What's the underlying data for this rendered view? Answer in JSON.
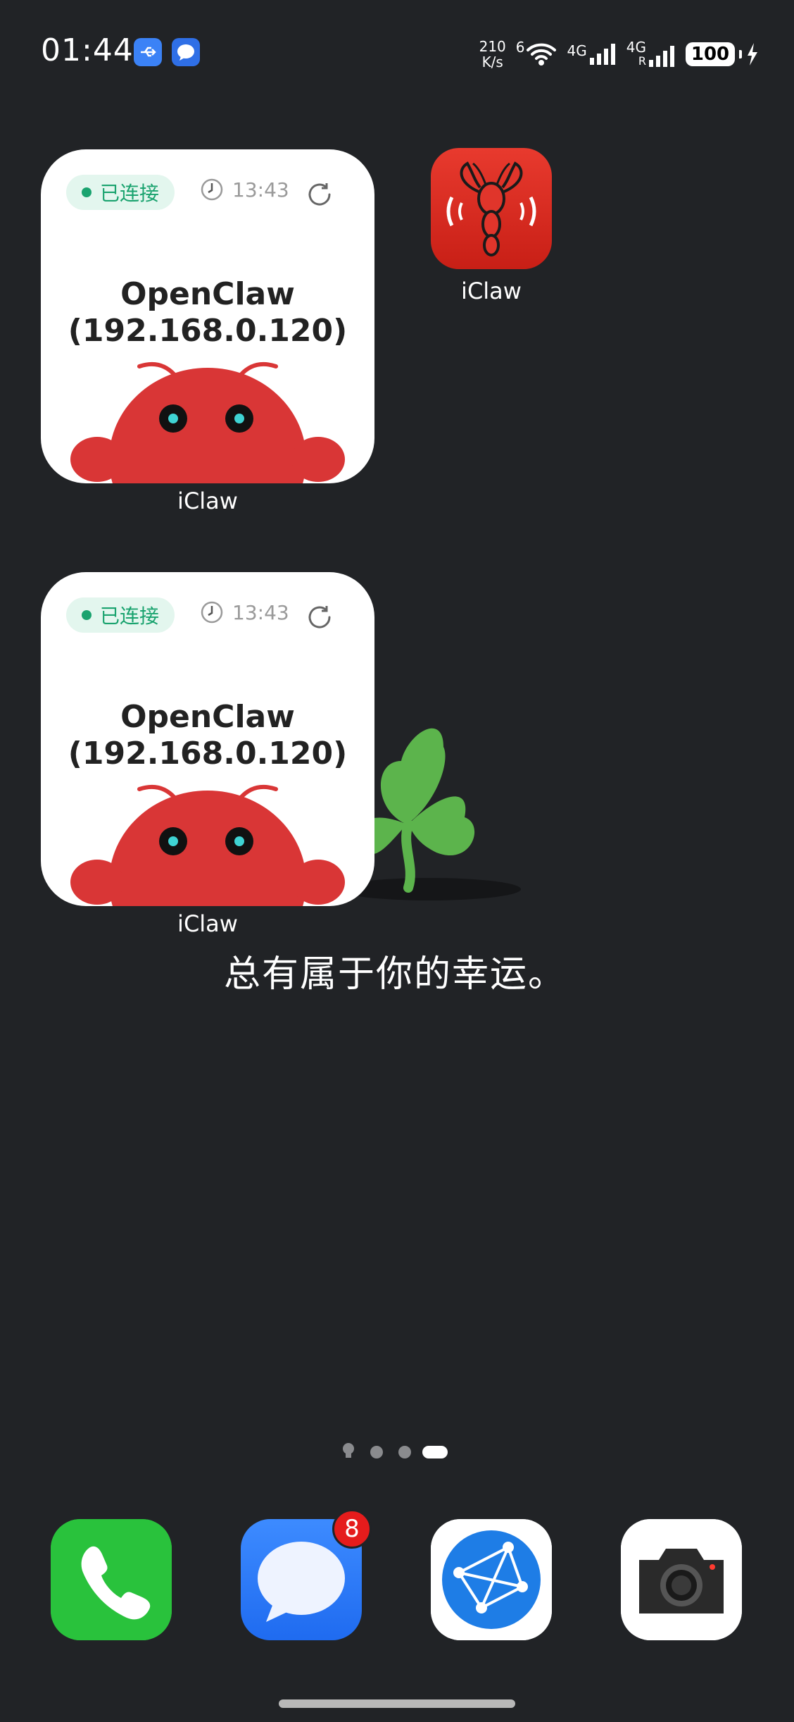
{
  "status_bar": {
    "time": "01:44",
    "net_speed_value": "210",
    "net_speed_unit": "K/s",
    "wifi_label": "6",
    "signal1_label": "4G",
    "signal2_label": "4G",
    "signal2_sub": "R",
    "battery": "100",
    "icons": [
      "usb-icon",
      "message-app-icon",
      "wifi-icon",
      "signal-icon",
      "battery-icon",
      "charging-icon"
    ]
  },
  "widgets": [
    {
      "status": "已连接",
      "time": "13:43",
      "title_line1": "OpenClaw",
      "title_line2": "(192.168.0.120)",
      "app_label": "iClaw"
    },
    {
      "status": "已连接",
      "time": "13:43",
      "title_line1": "OpenClaw",
      "title_line2": "(192.168.0.120)",
      "app_label": "iClaw"
    }
  ],
  "apps": {
    "iclaw_label": "iClaw"
  },
  "wallpaper": {
    "slogan": "总有属于你的幸运。"
  },
  "page_indicator": {
    "pages": 4,
    "current": 4
  },
  "dock": {
    "items": [
      "phone",
      "messages",
      "browser",
      "camera"
    ],
    "messages_badge": "8"
  },
  "colors": {
    "background": "#212326",
    "connected_green": "#1aa36f",
    "claw_red": "#d93636",
    "badge_red": "#e51c1c",
    "clover_green": "#5cb44c"
  }
}
